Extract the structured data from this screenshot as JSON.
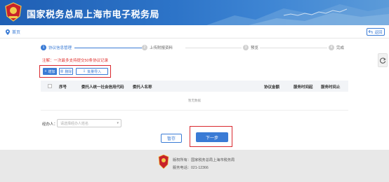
{
  "header": {
    "title": "国家税务总局上海市电子税务局"
  },
  "nav": {
    "home": "首页",
    "back": "返回"
  },
  "steps": [
    {
      "num": "1",
      "label": "协议信息管理"
    },
    {
      "num": "2",
      "label": "上传附报资料"
    },
    {
      "num": "3",
      "label": "预览"
    },
    {
      "num": "4",
      "label": "完成"
    }
  ],
  "notice": "注解：一次最多支持提交50条协议记录",
  "actions": {
    "add": "增加",
    "delete": "删除",
    "import": "批量导入"
  },
  "table": {
    "columns": [
      "序号",
      "委托人统一社会信用代码",
      "委托人名称",
      "协议金额",
      "服务时间起",
      "服务时间止"
    ],
    "empty_text": "暂无数据"
  },
  "handler": {
    "label": "经办人：",
    "placeholder": "请选择经办人姓名"
  },
  "buttons": {
    "save": "暂存",
    "next": "下一步"
  },
  "footer": {
    "copyright": "版权所有：国家税务总局上海市税务局",
    "phone": "服务电话：021-12366"
  },
  "colors": {
    "primary": "#3a7bd5",
    "highlight": "#d9282e",
    "header": "#2d74c8"
  }
}
